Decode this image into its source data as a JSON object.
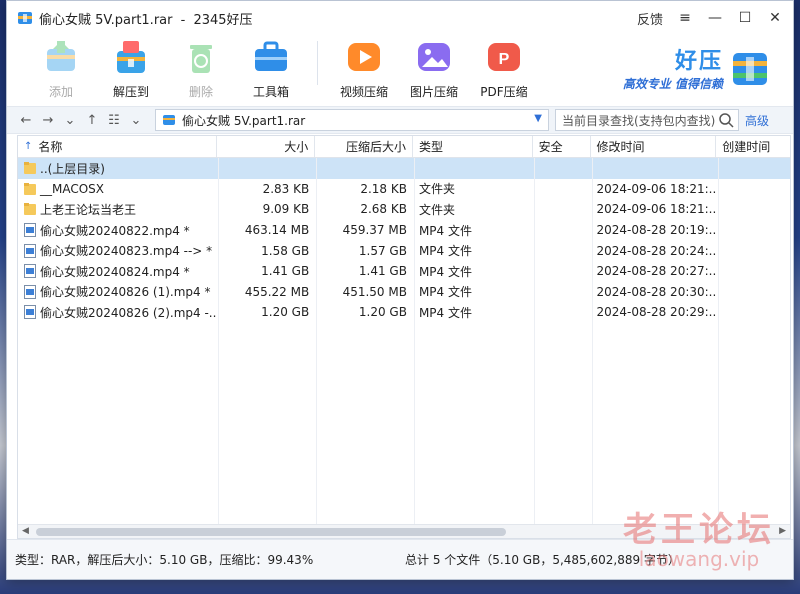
{
  "window": {
    "title": "偷心女贼 5V.part1.rar",
    "app_name": "2345好压",
    "feedback_label": "反馈"
  },
  "toolbar": {
    "items": [
      {
        "label": "添加",
        "icon": "add-archive-icon",
        "color": "#3aa3e8",
        "disabled": true
      },
      {
        "label": "解压到",
        "icon": "extract-icon",
        "color": "#3aa3e8",
        "disabled": false
      },
      {
        "label": "删除",
        "icon": "recycle-delete-icon",
        "color": "#44c15c",
        "disabled": true
      },
      {
        "label": "工具箱",
        "icon": "toolbox-icon",
        "color": "#2f8ee8",
        "disabled": false
      },
      {
        "label": "视频压缩",
        "icon": "video-compress-icon",
        "color": "#ff8a2a",
        "disabled": false
      },
      {
        "label": "图片压缩",
        "icon": "image-compress-icon",
        "color": "#8a6cf0",
        "disabled": false
      },
      {
        "label": "PDF压缩",
        "icon": "pdf-compress-icon",
        "color": "#f05a4a",
        "disabled": false
      }
    ],
    "brand_title": "好压",
    "brand_slogan": "高效专业 值得信赖"
  },
  "address": {
    "path": "偷心女贼 5V.part1.rar",
    "search_placeholder": "当前目录查找(支持包内查找)",
    "advanced_label": "高级"
  },
  "columns": [
    "名称",
    "大小",
    "压缩后大小",
    "类型",
    "安全",
    "修改时间",
    "创建时间"
  ],
  "files": [
    {
      "name": "..(上层目录)",
      "size": "",
      "packed": "",
      "type": "",
      "modified": "",
      "kind": "folder",
      "selected": true
    },
    {
      "name": "__MACOSX",
      "size": "2.83 KB",
      "packed": "2.18 KB",
      "type": "文件夹",
      "modified": "2024-09-06 18:21:...",
      "kind": "folder",
      "selected": false
    },
    {
      "name": "上老王论坛当老王",
      "size": "9.09 KB",
      "packed": "2.68 KB",
      "type": "文件夹",
      "modified": "2024-09-06 18:21:...",
      "kind": "folder",
      "selected": false
    },
    {
      "name": "偷心女贼20240822.mp4 *",
      "size": "463.14 MB",
      "packed": "459.37 MB",
      "type": "MP4 文件",
      "modified": "2024-08-28 20:19:...",
      "kind": "video",
      "selected": false
    },
    {
      "name": "偷心女贼20240823.mp4 --> *",
      "size": "1.58 GB",
      "packed": "1.57 GB",
      "type": "MP4 文件",
      "modified": "2024-08-28 20:24:...",
      "kind": "video",
      "selected": false
    },
    {
      "name": "偷心女贼20240824.mp4 *",
      "size": "1.41 GB",
      "packed": "1.41 GB",
      "type": "MP4 文件",
      "modified": "2024-08-28 20:27:...",
      "kind": "video",
      "selected": false
    },
    {
      "name": "偷心女贼20240826 (1).mp4 *",
      "size": "455.22 MB",
      "packed": "451.50 MB",
      "type": "MP4 文件",
      "modified": "2024-08-28 20:30:...",
      "kind": "video",
      "selected": false
    },
    {
      "name": "偷心女贼20240826 (2).mp4 -...",
      "size": "1.20 GB",
      "packed": "1.20 GB",
      "type": "MP4 文件",
      "modified": "2024-08-28 20:29:...",
      "kind": "video",
      "selected": false
    }
  ],
  "status": {
    "left": "类型：RAR，解压后大小：5.10 GB，压缩比：99.43%",
    "right": "总计 5 个文件（5.10 GB，5,485,602,889 字节）"
  },
  "watermark": {
    "line1": "老王论坛",
    "line2": "laowang.vip"
  }
}
